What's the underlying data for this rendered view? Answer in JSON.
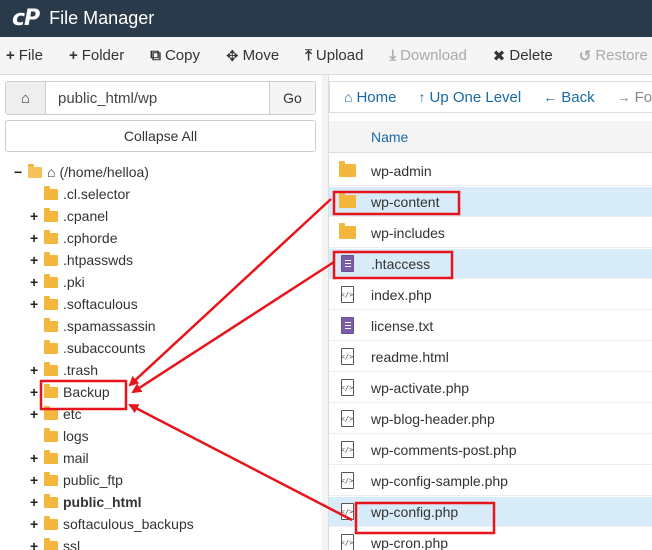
{
  "app": {
    "title": "File Manager",
    "logo": "cP"
  },
  "toolbar": [
    {
      "icon": "+",
      "icon_name": "plus-icon",
      "label": "File",
      "disabled": false
    },
    {
      "icon": "+",
      "icon_name": "plus-icon",
      "label": "Folder",
      "disabled": false
    },
    {
      "icon": "⧉",
      "icon_name": "copy-icon",
      "label": "Copy",
      "disabled": false
    },
    {
      "icon": "✥",
      "icon_name": "move-icon",
      "label": "Move",
      "disabled": false
    },
    {
      "icon": "⤒",
      "icon_name": "upload-icon",
      "label": "Upload",
      "disabled": false
    },
    {
      "icon": "⤓",
      "icon_name": "download-icon",
      "label": "Download",
      "disabled": true
    },
    {
      "icon": "✖",
      "icon_name": "delete-icon",
      "label": "Delete",
      "disabled": false
    },
    {
      "icon": "↺",
      "icon_name": "restore-icon",
      "label": "Restore",
      "disabled": true
    }
  ],
  "path_bar": {
    "value": "public_html/wp",
    "go_label": "Go"
  },
  "collapse_label": "Collapse All",
  "tree": {
    "root_label": "(/home/helloa)",
    "items": [
      {
        "label": ".cl.selector",
        "expandable": false,
        "bold": false
      },
      {
        "label": ".cpanel",
        "expandable": true,
        "bold": false
      },
      {
        "label": ".cphorde",
        "expandable": true,
        "bold": false
      },
      {
        "label": ".htpasswds",
        "expandable": true,
        "bold": false
      },
      {
        "label": ".pki",
        "expandable": true,
        "bold": false
      },
      {
        "label": ".softaculous",
        "expandable": true,
        "bold": false
      },
      {
        "label": ".spamassassin",
        "expandable": false,
        "bold": false
      },
      {
        "label": ".subaccounts",
        "expandable": false,
        "bold": false
      },
      {
        "label": ".trash",
        "expandable": true,
        "bold": false
      },
      {
        "label": "Backup",
        "expandable": true,
        "bold": false
      },
      {
        "label": "etc",
        "expandable": true,
        "bold": false
      },
      {
        "label": "logs",
        "expandable": false,
        "bold": false
      },
      {
        "label": "mail",
        "expandable": true,
        "bold": false
      },
      {
        "label": "public_ftp",
        "expandable": true,
        "bold": false
      },
      {
        "label": "public_html",
        "expandable": true,
        "bold": true
      },
      {
        "label": "softaculous_backups",
        "expandable": true,
        "bold": false
      },
      {
        "label": "ssl",
        "expandable": true,
        "bold": false
      }
    ]
  },
  "nav": {
    "home": "Home",
    "up": "Up One Level",
    "back": "Back",
    "forward": "Forward"
  },
  "list": {
    "column_name": "Name",
    "files": [
      {
        "name": "wp-admin",
        "type": "folder",
        "selected": false
      },
      {
        "name": "wp-content",
        "type": "folder",
        "selected": true
      },
      {
        "name": "wp-includes",
        "type": "folder",
        "selected": false
      },
      {
        "name": ".htaccess",
        "type": "text",
        "selected": true
      },
      {
        "name": "index.php",
        "type": "code",
        "selected": false
      },
      {
        "name": "license.txt",
        "type": "text",
        "selected": false
      },
      {
        "name": "readme.html",
        "type": "code",
        "selected": false
      },
      {
        "name": "wp-activate.php",
        "type": "code",
        "selected": false
      },
      {
        "name": "wp-blog-header.php",
        "type": "code",
        "selected": false
      },
      {
        "name": "wp-comments-post.php",
        "type": "code",
        "selected": false
      },
      {
        "name": "wp-config-sample.php",
        "type": "code",
        "selected": false
      },
      {
        "name": "wp-config.php",
        "type": "code",
        "selected": true
      },
      {
        "name": "wp-cron.php",
        "type": "code",
        "selected": false
      }
    ]
  },
  "colors": {
    "topbar": "#293a4a",
    "link": "#1a6aa6",
    "selected_row": "#d8ebf8",
    "folder": "#f2b73c",
    "annotation": "#e8141b"
  }
}
